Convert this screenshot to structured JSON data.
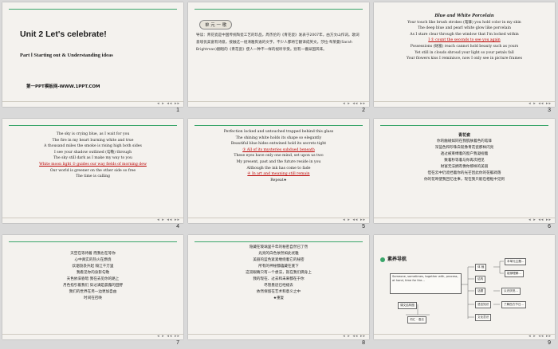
{
  "slides": [
    {
      "number": "1",
      "title": "Unit 2    Let's celebrate!",
      "subtitle": "Part  Ⅰ  Starting out  &  Understanding   ideas",
      "site": "第一PPT模板网-WWW.1PPT.COM"
    },
    {
      "number": "2",
      "badge": "单 元 一 歌",
      "text": "导读：青花瓷是中国传统陶瓷工艺的珍品，周杰伦的《青花瓷》发表于2007年，由方文山作词。歌词意境优美富有诗意。接触这一组清雅隽逸的文字，不少人都将它翻译成英文。莎拉·布莱曼(Sarah Brightman)翻唱的《青花瓷》使人一种不一样的视听享受。别有一番异国风味。"
    },
    {
      "number": "3",
      "title": "Blue and White Porcelain",
      "lines": [
        "Your touch like brush strokes (笔锋) you hold color in my skin",
        "The deep blue and pearl  white glow like porcelain",
        "As I stare clear  through the window that I'm locked within",
        "I ①  count the seconds  to see you   again",
        "Possessions (财富) reach  cannot hold beauty such as yours",
        "Yet still in clouds shroud your light so your petals fall",
        "Your flowers  kiss I reminisce,   now I only see in picture frames"
      ]
    },
    {
      "number": "4",
      "lines": [
        "The sky is crying blue,  as I wait for you",
        "The fire in my heart burning white and true",
        "A thousand miles the smoke is rising high both sides",
        "I see your shadow outlined (勾勒) through",
        "The sky still dark as I make my way to you",
        "White moon light ②   guides our way     fields of morning dew",
        "Our world is greener  on the other side so free",
        "The time is calling"
      ]
    },
    {
      "number": "5",
      "lines": [
        "Perfection  locked and untouched trapped behind this glass",
        "The shining white holds its shape so elegantly",
        "Beautiful  blue hides entwined hold its secrets tight",
        "③  All of its mysteries   subdued beneath",
        "These eyes have only one mind,  set upon us two",
        "My present,  past and the future reside in you",
        "Although the ink has come to fade",
        "④  In art and meaning   still remain",
        "Repeat★"
      ]
    },
    {
      "number": "6",
      "title": "青花瓷",
      "lines": [
        "你的触碰如同在我肌肤着色的笔锋",
        "深蓝色和珍珠白就像青花瓷那样闪亮",
        "透过被束缚着的窗户我凝视着",
        "数着秒等着与你再次相见",
        "财富无法拥有像你那样的美丽",
        "但在云中仍遮挡着你的光芒因此你的花瓣凋落",
        "你的花吻使我回忆往事，现在我只能在相框中见到"
      ]
    },
    {
      "number": "7",
      "lines": [
        "天空在等待着   而我也在等你",
        "心中真实的热火在燃烧",
        "炊烟袅袅升起   隔江千万里",
        "我看见你的身影勾勒",
        "天色依旧昏暗   我在去见你的路上",
        "月色指引着我们   穿过满是晨露的田野",
        "我们的世界在另一边更加自由",
        "时间在召唤"
      ]
    },
    {
      "number": "8",
      "lines": [
        "隐藏在玻璃里千年的秘密自然已了然",
        "光亮的白色依然如此优雅",
        "美丽的蓝色紧紧缠绕着它的秘密",
        "所有的神秘都蕴藏在底下",
        "这双眼睛只有一个想法，就在我们俩身上",
        "我的现在、过去和未来都在于你",
        "尽管墨迹已经褪去",
        "依然保留在艺术和意义之中",
        "★重复"
      ]
    },
    {
      "number": "9",
      "header": "素养导航",
      "mindmap": {
        "text_block": "Someone, sometimes, together with, process, at hand, time for the...",
        "nodes": [
          "体 裁",
          "结构",
          "话题",
          "语言知识",
          "文化意识"
        ],
        "right_notes": [
          "本单元主题...",
          "能够理解...",
          "认识庆祝...",
          "了解西方节日..."
        ],
        "bottom": [
          "课文结构图",
          "词汇 · 语法"
        ]
      }
    }
  ],
  "nav_icons": [
    "◂",
    "▸",
    "◂◂",
    "▸▸"
  ],
  "colors": {
    "accent_line": "#3aa66a",
    "highlight": "#b00000",
    "selection": "#e8a33a"
  }
}
